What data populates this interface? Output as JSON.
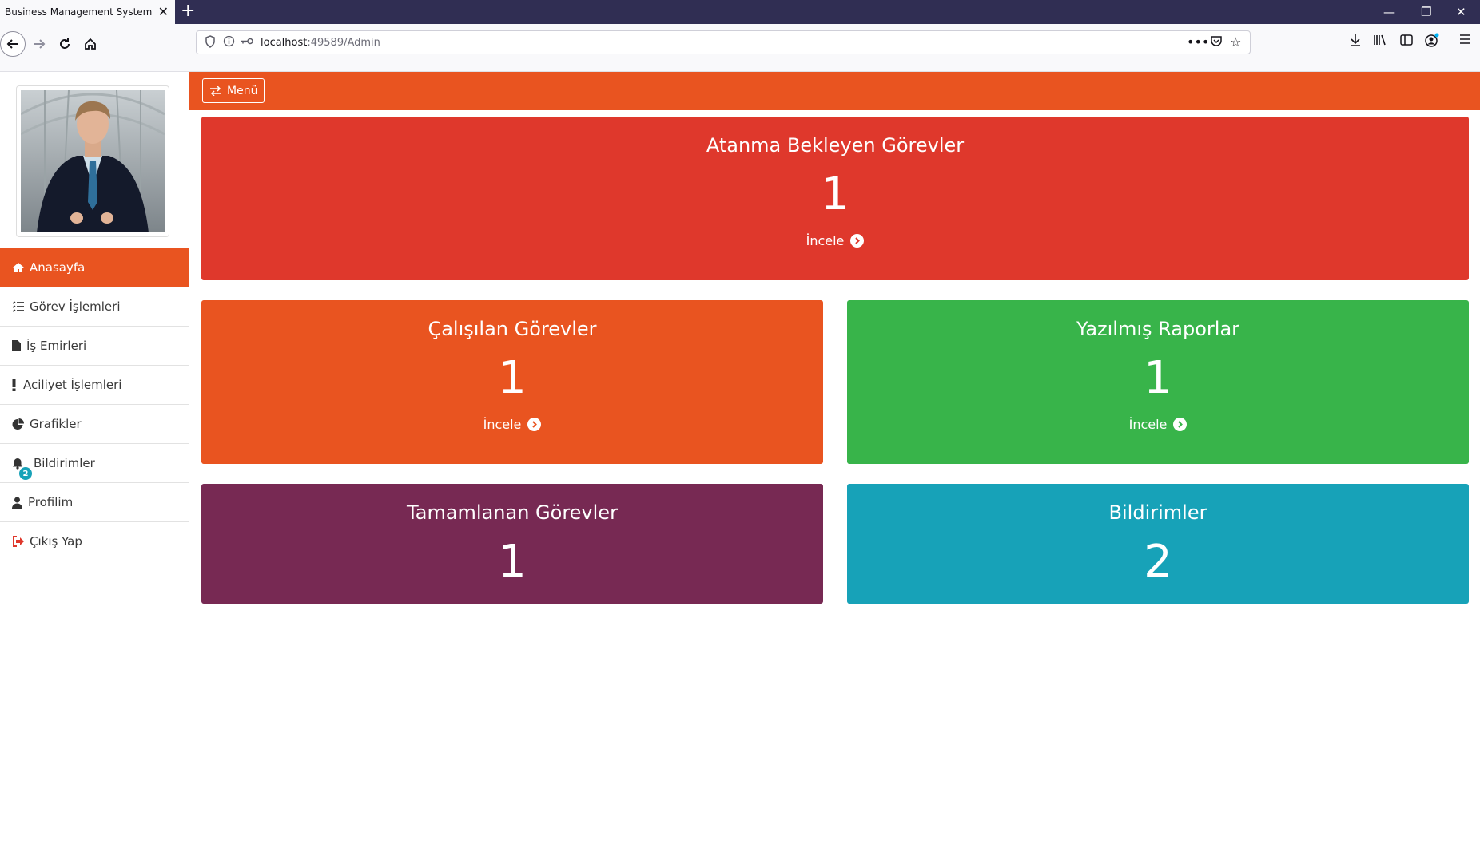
{
  "browser": {
    "tab_title": "Business Management System",
    "url_host": "localhost",
    "url_path": ":49589/Admin"
  },
  "topbar": {
    "menu_label": "Menü"
  },
  "sidebar": {
    "items": [
      {
        "label": "Anasayfa",
        "icon": "home-icon"
      },
      {
        "label": "Görev İşlemleri",
        "icon": "tasks-icon"
      },
      {
        "label": "İş Emirleri",
        "icon": "file-icon"
      },
      {
        "label": "Aciliyet İşlemleri",
        "icon": "exclamation-icon"
      },
      {
        "label": "Grafikler",
        "icon": "pie-chart-icon"
      },
      {
        "label": "Bildirimler",
        "icon": "bell-icon",
        "badge": "2"
      },
      {
        "label": "Profilim",
        "icon": "user-icon"
      },
      {
        "label": "Çıkış Yap",
        "icon": "sign-out-icon"
      }
    ]
  },
  "cards": {
    "pending": {
      "title": "Atanma Bekleyen Görevler",
      "count": "1",
      "link": "İncele",
      "color": "#df382c"
    },
    "working": {
      "title": "Çalışılan Görevler",
      "count": "1",
      "link": "İncele",
      "color": "#e95420"
    },
    "reports": {
      "title": "Yazılmış Raporlar",
      "count": "1",
      "link": "İncele",
      "color": "#38b44a"
    },
    "completed": {
      "title": "Tamamlanan Görevler",
      "count": "1",
      "color": "#772953"
    },
    "notifications": {
      "title": "Bildirimler",
      "count": "2",
      "color": "#17a2b8"
    }
  }
}
